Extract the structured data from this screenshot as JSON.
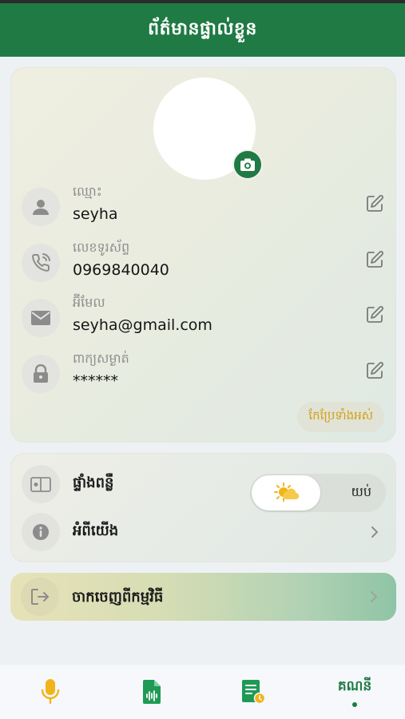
{
  "header": {
    "title": "ព័ត៌មានផ្ទាល់ខ្លួន"
  },
  "profile": {
    "fields": [
      {
        "label": "ឈ្មោះ",
        "value": "seyha",
        "icon": "user-icon"
      },
      {
        "label": "លេខទូរស័ព្ទ",
        "value": "0969840040",
        "icon": "phone-icon"
      },
      {
        "label": "អ៊ីមែល",
        "value": "seyha@gmail.com",
        "icon": "mail-icon"
      },
      {
        "label": "ពាក្យសម្ងាត់",
        "value": "******",
        "icon": "lock-icon"
      }
    ],
    "edit_all_label": "កែប្រែទាំងអស់"
  },
  "settings": {
    "theme_label": "ផ្ទាំងពន្លឺ",
    "theme_night_label": "យប់",
    "about_label": "អំពីយើង"
  },
  "logout": {
    "label": "ចាកចេញពីកម្មវិធី"
  },
  "nav": {
    "items": [
      {
        "icon": "microphone-icon"
      },
      {
        "icon": "audio-file-icon"
      },
      {
        "icon": "document-history-icon"
      },
      {
        "label": "គណនី"
      }
    ]
  },
  "colors": {
    "primary": "#1f7a44",
    "accent": "#d2a017",
    "mic": "#f2b41b"
  }
}
